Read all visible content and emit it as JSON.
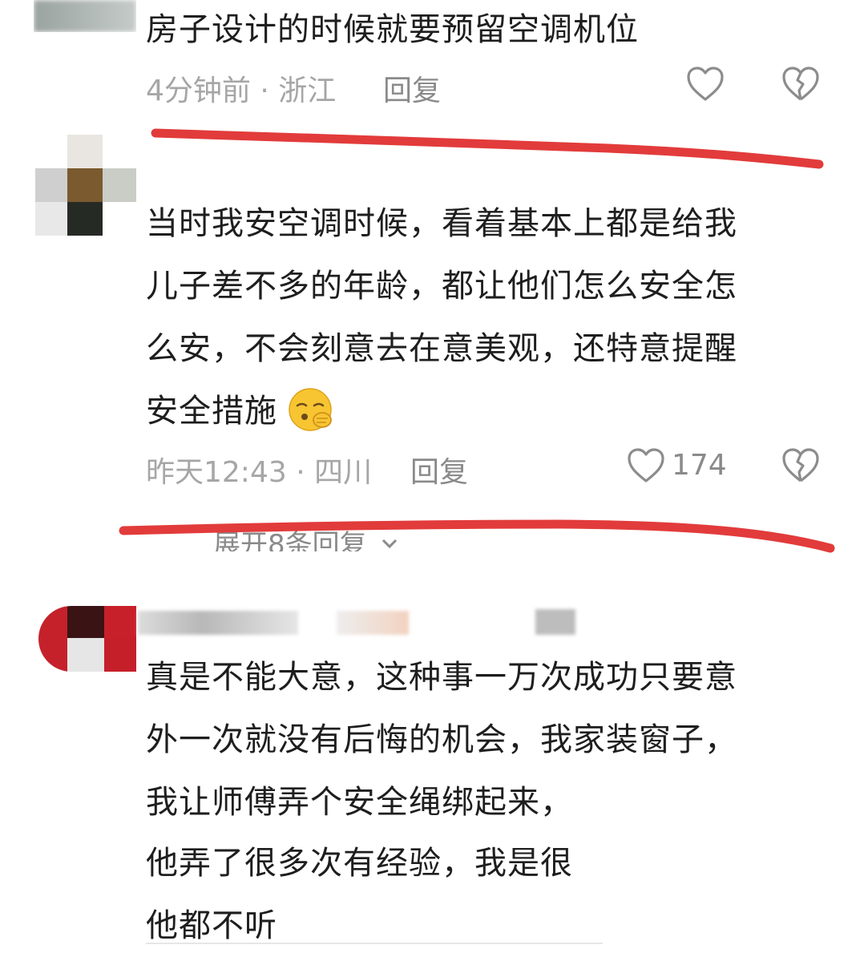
{
  "comments": [
    {
      "text_lines": [
        "房子设计的时候就要预留空调机位"
      ],
      "time": "4分钟前",
      "location": "浙江",
      "reply_label": "回复",
      "like_count": ""
    },
    {
      "text_lines": [
        "当时我安空调时候，看着基本上都是给我",
        "儿子差不多的年龄，都让他们怎么安全怎",
        "么安，不会刻意去在意美观，还特意提醒",
        "安全措施"
      ],
      "time": "昨天12:43",
      "location": "四川",
      "reply_label": "回复",
      "like_count": "174",
      "expand_label": "展开8条回复"
    },
    {
      "text_lines": [
        "真是不能大意，这种事一万次成功只要意",
        "外一次就没有后悔的机会，我家装窗子，",
        "我让师傅弄个安全绳绑起来，",
        "他弄了很多次有经验，我是很",
        "他都不听"
      ]
    }
  ],
  "separator": " · ",
  "colors": {
    "annotation_red": "#e23b3b",
    "meta_gray": "#a6a6a6",
    "icon_gray": "#8c8c8c"
  },
  "icons": {
    "like": "heart-outline-icon",
    "dislike": "broken-heart-icon",
    "emoji": "shushing-face-emoji",
    "expand": "chevron-down-icon"
  }
}
